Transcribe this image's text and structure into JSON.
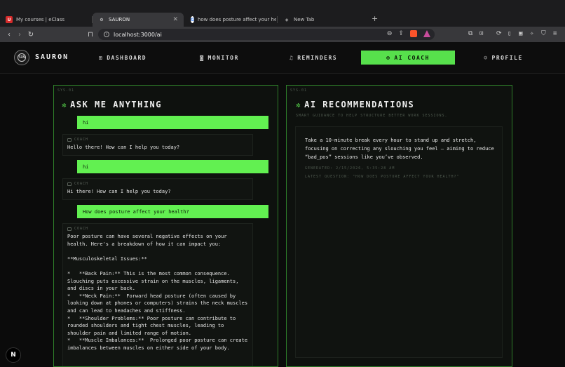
{
  "browser": {
    "tabs": [
      {
        "title": "My courses | eClass",
        "fav": "U"
      },
      {
        "title": "SAURON",
        "fav": "⚙"
      },
      {
        "title": "how does posture affect your heal",
        "fav": "G"
      },
      {
        "title": "New Tab",
        "fav": "◈"
      }
    ],
    "url": "localhost:3000/ai",
    "new_tab_symbol": "+"
  },
  "app": {
    "brand": "SAURON",
    "logo_text": "SRN",
    "nav": [
      {
        "label": "DASHBOARD",
        "icon": "grid-icon"
      },
      {
        "label": "MONITOR",
        "icon": "camera-icon"
      },
      {
        "label": "REMINDERS",
        "icon": "bell-icon"
      },
      {
        "label": "AI COACH",
        "icon": "compass-icon"
      },
      {
        "label": "PROFILE",
        "icon": "user-icon"
      }
    ],
    "active_nav": "AI COACH",
    "accent": "#57e04c"
  },
  "chat": {
    "sys_label": "SYS-01",
    "title": "ASK ME ANYTHING",
    "coach_label": "COACH",
    "messages": [
      {
        "role": "user",
        "text": "hi"
      },
      {
        "role": "coach",
        "text": "Hello there! How can I help you today?"
      },
      {
        "role": "user",
        "text": "hi"
      },
      {
        "role": "coach",
        "text": "Hi there! How can I help you today?"
      },
      {
        "role": "user",
        "text": "How does posture affect your health?"
      },
      {
        "role": "coach",
        "text": "Poor posture can have several negative effects on your health. Here's a breakdown of how it can impact you:\n\n**Musculoskeletal Issues:**\n\n*   **Back Pain:** This is the most common consequence. Slouching puts excessive strain on the muscles, ligaments, and discs in your back.\n*   **Neck Pain:**  Forward head posture (often caused by looking down at phones or computers) strains the neck muscles and can lead to headaches and stiffness.\n*   **Shoulder Problems:** Poor posture can contribute to rounded shoulders and tight chest muscles, leading to shoulder pain and limited range of motion.\n*   **Muscle Imbalances:**  Prolonged poor posture can create imbalances between muscles on either side of your body."
      }
    ]
  },
  "recommendations": {
    "sys_label": "SYS-01",
    "title": "AI RECOMMENDATIONS",
    "subtitle": "SMART GUIDANCE TO HELP STRUCTURE BETTER WORK SESSIONS.",
    "text": "Take a 10-minute break every hour to stand up and stretch, focusing on correcting any slouching you feel – aiming to reduce “bad_pos” sessions like you’ve observed.",
    "generated": "GENERATED: 2/15/2026, 5:35:28 AM",
    "latest_question": "LATEST QUESTION: \"HOW DOES POSTURE AFFECT YOUR HEALTH?\""
  },
  "dev_badge": "N"
}
